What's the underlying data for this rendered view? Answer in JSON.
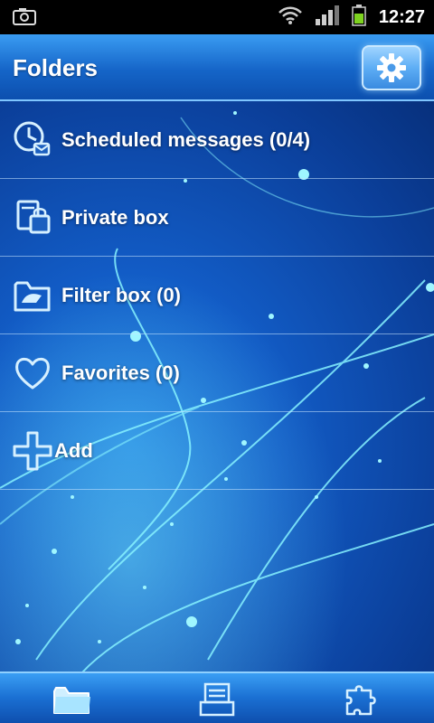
{
  "status_bar": {
    "time": "12:27",
    "icons": [
      "screenshot-icon",
      "wifi-icon",
      "signal-icon",
      "battery-icon"
    ]
  },
  "header": {
    "title": "Folders",
    "settings_icon": "gear-icon"
  },
  "folders": [
    {
      "label": "Scheduled messages (0/4)",
      "icon": "clock-message-icon"
    },
    {
      "label": "Private box",
      "icon": "private-box-icon"
    },
    {
      "label": "Filter box (0)",
      "icon": "filter-folder-icon"
    },
    {
      "label": "Favorites (0)",
      "icon": "heart-icon"
    },
    {
      "label": "Add",
      "icon": "plus-icon"
    }
  ],
  "bottom_tabs": [
    {
      "name": "folders",
      "icon": "folder-icon",
      "active": true
    },
    {
      "name": "messages",
      "icon": "message-list-icon",
      "active": false
    },
    {
      "name": "plugins",
      "icon": "puzzle-icon",
      "active": false
    }
  ],
  "colors": {
    "accent": "#7fd6ff",
    "background": "#0b3f9a",
    "header": "#1565c8"
  }
}
